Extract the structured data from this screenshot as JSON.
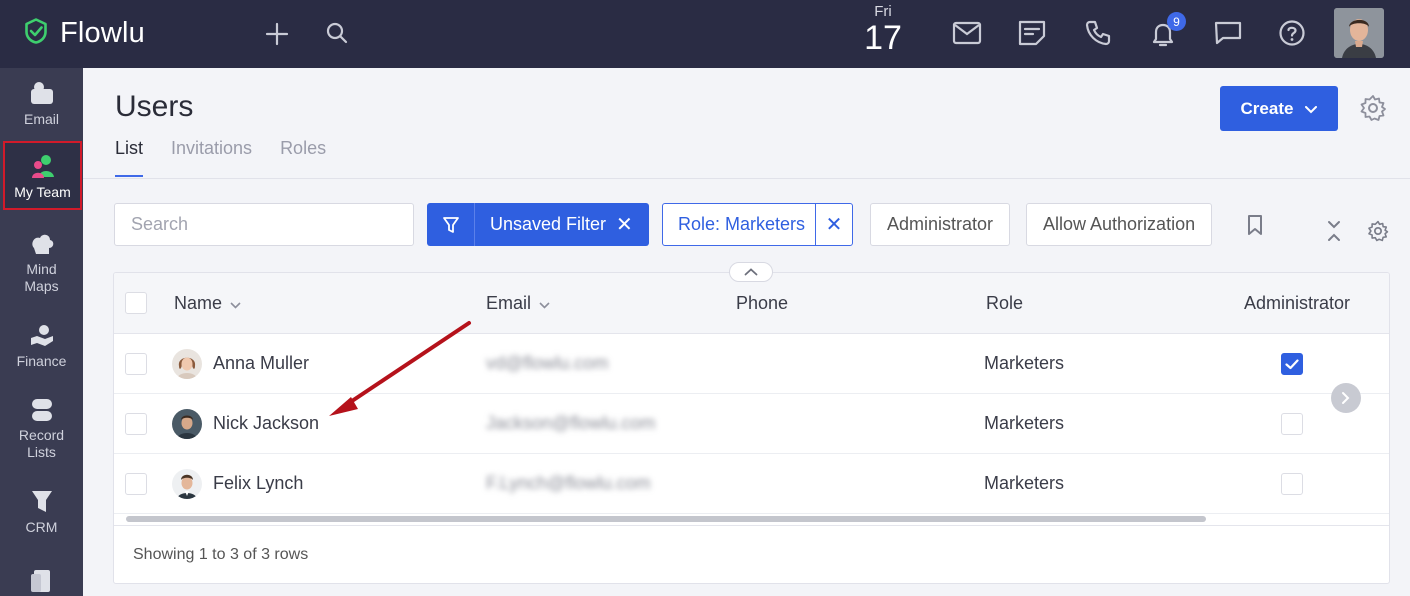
{
  "app": {
    "name": "Flowlu"
  },
  "topbar": {
    "date_dow": "Fri",
    "date_day": "17",
    "notifications_count": "9",
    "icons": [
      "plus-icon",
      "search-icon",
      "mail-icon",
      "notes-icon",
      "phone-icon",
      "bell-icon",
      "chat-icon",
      "help-icon"
    ]
  },
  "sidebar": {
    "items": [
      {
        "label": "Email",
        "icon": "email-app-icon"
      },
      {
        "label": "My Team",
        "icon": "team-icon",
        "active": true
      },
      {
        "label": "Mind Maps",
        "icon": "mind-map-icon"
      },
      {
        "label": "Finance",
        "icon": "finance-icon"
      },
      {
        "label": "Record Lists",
        "icon": "record-lists-icon"
      },
      {
        "label": "CRM",
        "icon": "crm-icon"
      }
    ]
  },
  "page": {
    "title": "Users",
    "tabs": [
      {
        "label": "List",
        "active": true
      },
      {
        "label": "Invitations"
      },
      {
        "label": "Roles"
      }
    ],
    "create_label": "Create"
  },
  "filters": {
    "search_placeholder": "Search",
    "unsaved_filter_label": "Unsaved Filter",
    "role_chip_label": "Role: Marketers",
    "chips": [
      "Administrator",
      "Allow Authorization"
    ]
  },
  "table": {
    "columns": [
      "Name",
      "Email",
      "Phone",
      "Role",
      "Administrator"
    ],
    "rows": [
      {
        "name": "Anna Muller",
        "email": "vd@flowlu.com",
        "phone": "",
        "role": "Marketers",
        "administrator": true
      },
      {
        "name": "Nick Jackson",
        "email": "Jackson@flowlu.com",
        "phone": "",
        "role": "Marketers",
        "administrator": false
      },
      {
        "name": "Felix Lynch",
        "email": "F.Lynch@flowlu.com",
        "phone": "",
        "role": "Marketers",
        "administrator": false
      }
    ],
    "footer": "Showing 1 to 3 of 3 rows"
  },
  "colors": {
    "topbar": "#2a2c44",
    "sidebar": "#3a3c52",
    "accent": "#2f5fe0",
    "logo_green": "#3ecf6e",
    "annotation_arrow": "#b5121b"
  }
}
